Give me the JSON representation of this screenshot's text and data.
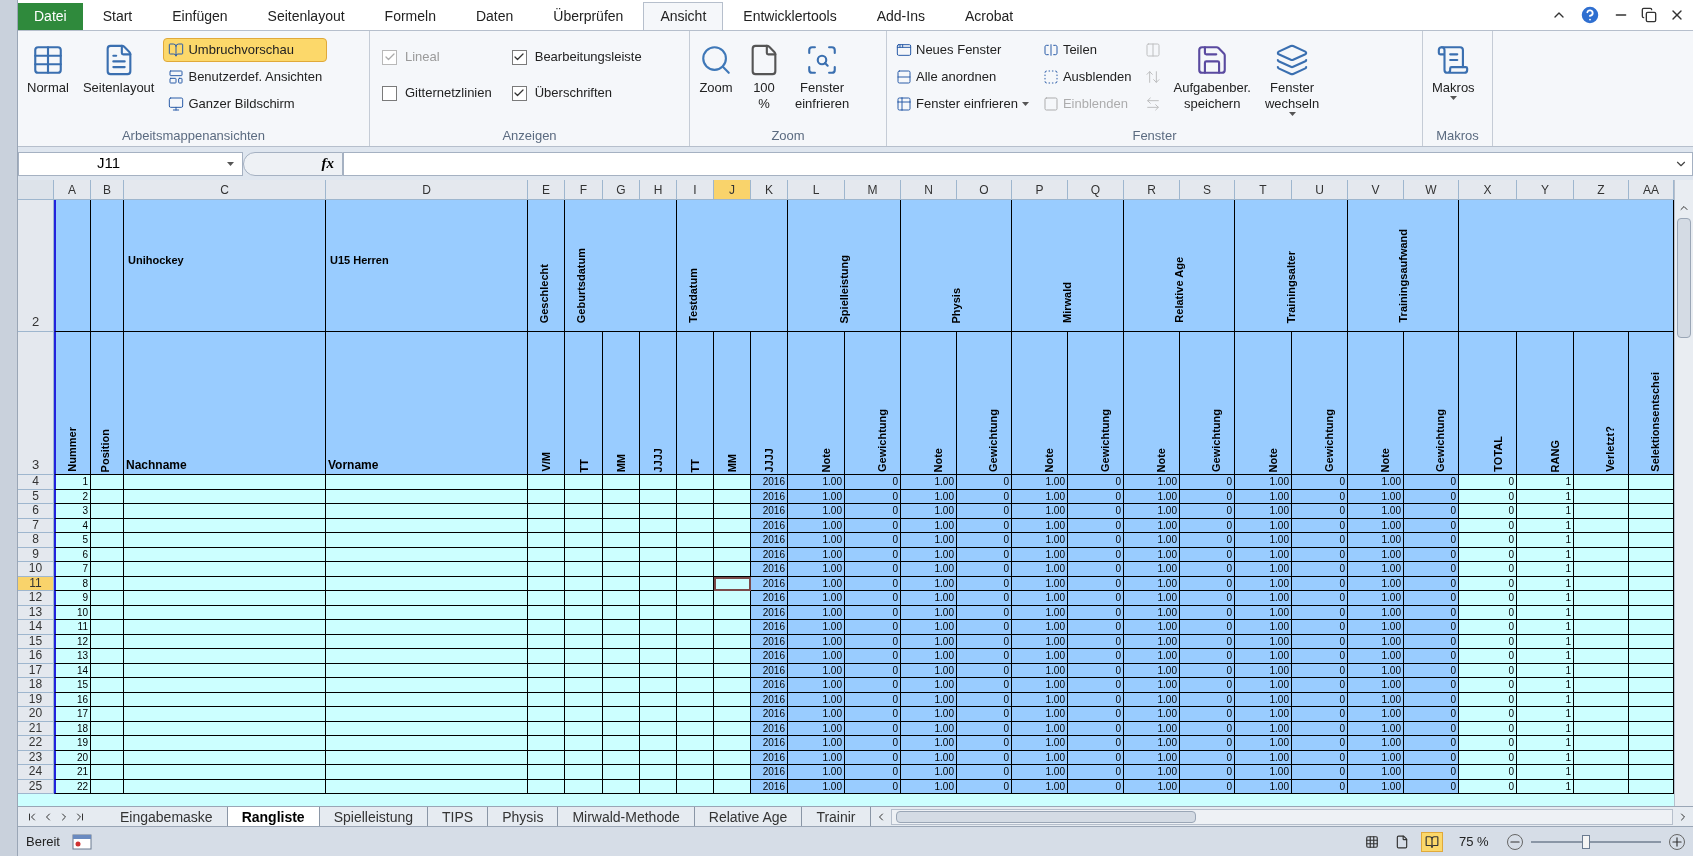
{
  "ribbon_tabs": [
    {
      "label": "Datei",
      "kind": "file",
      "selected": false
    },
    {
      "label": "Start",
      "kind": "tab",
      "selected": false
    },
    {
      "label": "Einfügen",
      "kind": "tab",
      "selected": false
    },
    {
      "label": "Seitenlayout",
      "kind": "tab",
      "selected": false
    },
    {
      "label": "Formeln",
      "kind": "tab",
      "selected": false
    },
    {
      "label": "Daten",
      "kind": "tab",
      "selected": false
    },
    {
      "label": "Überprüfen",
      "kind": "tab",
      "selected": false
    },
    {
      "label": "Ansicht",
      "kind": "tab",
      "selected": true
    },
    {
      "label": "Entwicklertools",
      "kind": "tab",
      "selected": false
    },
    {
      "label": "Add-Ins",
      "kind": "tab",
      "selected": false
    },
    {
      "label": "Acrobat",
      "kind": "tab",
      "selected": false
    }
  ],
  "ribbon_groups": [
    {
      "title": "Arbeitsmappenansichten",
      "items": [
        {
          "kind": "large",
          "label": "Normal",
          "selected": false
        },
        {
          "kind": "large",
          "label": "Seitenlayout",
          "selected": false
        },
        {
          "kind": "small",
          "label": "Umbruchvorschau",
          "selected": true
        },
        {
          "kind": "small",
          "label": "Benutzerdef. Ansichten",
          "selected": false
        },
        {
          "kind": "small",
          "label": "Ganzer Bildschirm",
          "selected": false
        }
      ]
    },
    {
      "title": "Anzeigen",
      "items": [
        {
          "kind": "checkbox",
          "label": "Lineal",
          "checked": true,
          "disabled": true
        },
        {
          "kind": "checkbox",
          "label": "Gitternetzlinien",
          "checked": false,
          "disabled": false
        },
        {
          "kind": "checkbox",
          "label": "Bearbeitungsleiste",
          "checked": true,
          "disabled": false
        },
        {
          "kind": "checkbox",
          "label": "Überschriften",
          "checked": true,
          "disabled": false
        }
      ]
    },
    {
      "title": "Zoom",
      "items": [
        {
          "kind": "large",
          "label": "Zoom"
        },
        {
          "kind": "large",
          "label": "100\n%"
        },
        {
          "kind": "large",
          "label": "Fenster\neinfrieren"
        }
      ]
    },
    {
      "title": "Fenster",
      "items": [
        {
          "kind": "small",
          "label": "Neues Fenster",
          "disabled": false
        },
        {
          "kind": "small",
          "label": "Alle anordnen",
          "disabled": false
        },
        {
          "kind": "small",
          "label": "Fenster einfrieren",
          "dropdown": true,
          "disabled": false
        },
        {
          "kind": "small",
          "label": "Teilen",
          "disabled": false
        },
        {
          "kind": "small",
          "label": "Ausblenden",
          "disabled": false
        },
        {
          "kind": "small",
          "label": "Einblenden",
          "disabled": true
        },
        {
          "kind": "icon",
          "disabled": true
        },
        {
          "kind": "icon",
          "disabled": true
        },
        {
          "kind": "icon",
          "disabled": true
        },
        {
          "kind": "large",
          "label": "Aufgabenber.\nspeichern"
        },
        {
          "kind": "large",
          "label": "Fenster\nwechseln",
          "dropdown": true
        }
      ]
    },
    {
      "title": "Makros",
      "items": [
        {
          "kind": "large",
          "label": "Makros",
          "dropdown": true
        }
      ]
    }
  ],
  "name_box": {
    "value": "J11"
  },
  "formula_bar": {
    "fx_label": "fx"
  },
  "sheet": {
    "columns": [
      {
        "label": "A",
        "selected": false
      },
      {
        "label": "B",
        "selected": false
      },
      {
        "label": "C",
        "selected": false
      },
      {
        "label": "D",
        "selected": false
      },
      {
        "label": "E",
        "selected": false
      },
      {
        "label": "F",
        "selected": false
      },
      {
        "label": "G",
        "selected": false
      },
      {
        "label": "H",
        "selected": false
      },
      {
        "label": "I",
        "selected": false
      },
      {
        "label": "J",
        "selected": true
      },
      {
        "label": "K",
        "selected": false
      },
      {
        "label": "L",
        "selected": false
      },
      {
        "label": "M",
        "selected": false
      },
      {
        "label": "N",
        "selected": false
      },
      {
        "label": "O",
        "selected": false
      },
      {
        "label": "P",
        "selected": false
      },
      {
        "label": "Q",
        "selected": false
      },
      {
        "label": "R",
        "selected": false
      },
      {
        "label": "S",
        "selected": false
      },
      {
        "label": "T",
        "selected": false
      },
      {
        "label": "U",
        "selected": false
      },
      {
        "label": "V",
        "selected": false
      },
      {
        "label": "W",
        "selected": false
      },
      {
        "label": "X",
        "selected": false
      },
      {
        "label": "Y",
        "selected": false
      },
      {
        "label": "Z",
        "selected": false
      },
      {
        "label": "AA",
        "selected": false
      }
    ],
    "header_row_2": {
      "header": "2",
      "cells": [
        {
          "kind": "empty"
        },
        {
          "kind": "empty"
        },
        {
          "kind": "horizontal",
          "label": "Unihockey"
        },
        {
          "kind": "horizontal",
          "label": "U15 Herren"
        },
        {
          "kind": "vertical",
          "label": "Geschlecht"
        },
        {
          "kind": "vertical",
          "label": "Geburtsdatum"
        },
        {
          "kind": "vertical",
          "label": "Testdatum"
        },
        {
          "kind": "vertical",
          "label": "Spielleistung"
        },
        {
          "kind": "vertical",
          "label": "Physis"
        },
        {
          "kind": "vertical",
          "label": "Mirwald"
        },
        {
          "kind": "vertical",
          "label": "Relative Age"
        },
        {
          "kind": "vertical",
          "label": "Trainingsalter"
        },
        {
          "kind": "vertical",
          "label": "Trainingsaufwand"
        },
        {
          "kind": "empty"
        }
      ]
    },
    "header_row_3": {
      "header": "3",
      "cells": [
        {
          "kind": "vertical",
          "label": "Nummer"
        },
        {
          "kind": "vertical",
          "label": "Position"
        },
        {
          "kind": "horizontal",
          "label": "Nachname"
        },
        {
          "kind": "horizontal",
          "label": "Vorname"
        },
        {
          "kind": "vertical",
          "label": "V/M"
        },
        {
          "kind": "vertical",
          "label": "TT"
        },
        {
          "kind": "vertical",
          "label": "MM"
        },
        {
          "kind": "vertical",
          "label": "JJJJ"
        },
        {
          "kind": "vertical",
          "label": "TT"
        },
        {
          "kind": "vertical",
          "label": "MM"
        },
        {
          "kind": "vertical",
          "label": "JJJJ"
        },
        {
          "kind": "vertical",
          "label": "Note"
        },
        {
          "kind": "vertical",
          "label": "Gewichtung"
        },
        {
          "kind": "vertical",
          "label": "Note"
        },
        {
          "kind": "vertical",
          "label": "Gewichtung"
        },
        {
          "kind": "vertical",
          "label": "Note"
        },
        {
          "kind": "vertical",
          "label": "Gewichtung"
        },
        {
          "kind": "vertical",
          "label": "Note"
        },
        {
          "kind": "vertical",
          "label": "Gewichtung"
        },
        {
          "kind": "vertical",
          "label": "Note"
        },
        {
          "kind": "vertical",
          "label": "Gewichtung"
        },
        {
          "kind": "vertical",
          "label": "Note"
        },
        {
          "kind": "vertical",
          "label": "Gewichtung"
        },
        {
          "kind": "vertical",
          "label": "TOTAL"
        },
        {
          "kind": "vertical",
          "label": "RANG"
        },
        {
          "kind": "vertical",
          "label": "Verletzt?"
        },
        {
          "kind": "vertical",
          "label": "Selektionsentschei"
        }
      ]
    },
    "rows": [
      {
        "header": "4",
        "selected": false,
        "number": "1",
        "values": [
          "2016",
          "1.00",
          "0",
          "1.00",
          "0",
          "1.00",
          "0",
          "1.00",
          "0",
          "1.00",
          "0",
          "1.00",
          "0",
          "0",
          "1"
        ]
      },
      {
        "header": "5",
        "selected": false,
        "number": "2",
        "values": [
          "2016",
          "1.00",
          "0",
          "1.00",
          "0",
          "1.00",
          "0",
          "1.00",
          "0",
          "1.00",
          "0",
          "1.00",
          "0",
          "0",
          "1"
        ]
      },
      {
        "header": "6",
        "selected": false,
        "number": "3",
        "values": [
          "2016",
          "1.00",
          "0",
          "1.00",
          "0",
          "1.00",
          "0",
          "1.00",
          "0",
          "1.00",
          "0",
          "1.00",
          "0",
          "0",
          "1"
        ]
      },
      {
        "header": "7",
        "selected": false,
        "number": "4",
        "values": [
          "2016",
          "1.00",
          "0",
          "1.00",
          "0",
          "1.00",
          "0",
          "1.00",
          "0",
          "1.00",
          "0",
          "1.00",
          "0",
          "0",
          "1"
        ]
      },
      {
        "header": "8",
        "selected": false,
        "number": "5",
        "values": [
          "2016",
          "1.00",
          "0",
          "1.00",
          "0",
          "1.00",
          "0",
          "1.00",
          "0",
          "1.00",
          "0",
          "1.00",
          "0",
          "0",
          "1"
        ]
      },
      {
        "header": "9",
        "selected": false,
        "number": "6",
        "values": [
          "2016",
          "1.00",
          "0",
          "1.00",
          "0",
          "1.00",
          "0",
          "1.00",
          "0",
          "1.00",
          "0",
          "1.00",
          "0",
          "0",
          "1"
        ]
      },
      {
        "header": "10",
        "selected": false,
        "number": "7",
        "values": [
          "2016",
          "1.00",
          "0",
          "1.00",
          "0",
          "1.00",
          "0",
          "1.00",
          "0",
          "1.00",
          "0",
          "1.00",
          "0",
          "0",
          "1"
        ]
      },
      {
        "header": "11",
        "selected": true,
        "number": "8",
        "values": [
          "2016",
          "1.00",
          "0",
          "1.00",
          "0",
          "1.00",
          "0",
          "1.00",
          "0",
          "1.00",
          "0",
          "1.00",
          "0",
          "0",
          "1"
        ]
      },
      {
        "header": "12",
        "selected": false,
        "number": "9",
        "values": [
          "2016",
          "1.00",
          "0",
          "1.00",
          "0",
          "1.00",
          "0",
          "1.00",
          "0",
          "1.00",
          "0",
          "1.00",
          "0",
          "0",
          "1"
        ]
      },
      {
        "header": "13",
        "selected": false,
        "number": "10",
        "values": [
          "2016",
          "1.00",
          "0",
          "1.00",
          "0",
          "1.00",
          "0",
          "1.00",
          "0",
          "1.00",
          "0",
          "1.00",
          "0",
          "0",
          "1"
        ]
      },
      {
        "header": "14",
        "selected": false,
        "number": "11",
        "values": [
          "2016",
          "1.00",
          "0",
          "1.00",
          "0",
          "1.00",
          "0",
          "1.00",
          "0",
          "1.00",
          "0",
          "1.00",
          "0",
          "0",
          "1"
        ]
      },
      {
        "header": "15",
        "selected": false,
        "number": "12",
        "values": [
          "2016",
          "1.00",
          "0",
          "1.00",
          "0",
          "1.00",
          "0",
          "1.00",
          "0",
          "1.00",
          "0",
          "1.00",
          "0",
          "0",
          "1"
        ]
      },
      {
        "header": "16",
        "selected": false,
        "number": "13",
        "values": [
          "2016",
          "1.00",
          "0",
          "1.00",
          "0",
          "1.00",
          "0",
          "1.00",
          "0",
          "1.00",
          "0",
          "1.00",
          "0",
          "0",
          "1"
        ]
      },
      {
        "header": "17",
        "selected": false,
        "number": "14",
        "values": [
          "2016",
          "1.00",
          "0",
          "1.00",
          "0",
          "1.00",
          "0",
          "1.00",
          "0",
          "1.00",
          "0",
          "1.00",
          "0",
          "0",
          "1"
        ]
      },
      {
        "header": "18",
        "selected": false,
        "number": "15",
        "values": [
          "2016",
          "1.00",
          "0",
          "1.00",
          "0",
          "1.00",
          "0",
          "1.00",
          "0",
          "1.00",
          "0",
          "1.00",
          "0",
          "0",
          "1"
        ]
      },
      {
        "header": "19",
        "selected": false,
        "number": "16",
        "values": [
          "2016",
          "1.00",
          "0",
          "1.00",
          "0",
          "1.00",
          "0",
          "1.00",
          "0",
          "1.00",
          "0",
          "1.00",
          "0",
          "0",
          "1"
        ]
      },
      {
        "header": "20",
        "selected": false,
        "number": "17",
        "values": [
          "2016",
          "1.00",
          "0",
          "1.00",
          "0",
          "1.00",
          "0",
          "1.00",
          "0",
          "1.00",
          "0",
          "1.00",
          "0",
          "0",
          "1"
        ]
      },
      {
        "header": "21",
        "selected": false,
        "number": "18",
        "values": [
          "2016",
          "1.00",
          "0",
          "1.00",
          "0",
          "1.00",
          "0",
          "1.00",
          "0",
          "1.00",
          "0",
          "1.00",
          "0",
          "0",
          "1"
        ]
      },
      {
        "header": "22",
        "selected": false,
        "number": "19",
        "values": [
          "2016",
          "1.00",
          "0",
          "1.00",
          "0",
          "1.00",
          "0",
          "1.00",
          "0",
          "1.00",
          "0",
          "1.00",
          "0",
          "0",
          "1"
        ]
      },
      {
        "header": "23",
        "selected": false,
        "number": "20",
        "values": [
          "2016",
          "1.00",
          "0",
          "1.00",
          "0",
          "1.00",
          "0",
          "1.00",
          "0",
          "1.00",
          "0",
          "1.00",
          "0",
          "0",
          "1"
        ]
      },
      {
        "header": "24",
        "selected": false,
        "number": "21",
        "values": [
          "2016",
          "1.00",
          "0",
          "1.00",
          "0",
          "1.00",
          "0",
          "1.00",
          "0",
          "1.00",
          "0",
          "1.00",
          "0",
          "0",
          "1"
        ]
      },
      {
        "header": "25",
        "selected": false,
        "number": "22",
        "values": [
          "2016",
          "1.00",
          "0",
          "1.00",
          "0",
          "1.00",
          "0",
          "1.00",
          "0",
          "1.00",
          "0",
          "1.00",
          "0",
          "0",
          "1"
        ]
      }
    ]
  },
  "sheet_tabs": [
    {
      "label": "Eingabemaske",
      "selected": false
    },
    {
      "label": "Rangliste",
      "selected": true
    },
    {
      "label": "Spielleistung",
      "selected": false
    },
    {
      "label": "TIPS",
      "selected": false
    },
    {
      "label": "Physis",
      "selected": false
    },
    {
      "label": "Mirwald-Methode",
      "selected": false
    },
    {
      "label": "Relative Age",
      "selected": false
    },
    {
      "label": "Trainir",
      "selected": false
    }
  ],
  "status_bar": {
    "status": "Bereit",
    "view_buttons": [
      {
        "selected": false
      },
      {
        "selected": false
      },
      {
        "selected": true
      }
    ],
    "zoom": "75 %",
    "zoom_slider": {
      "level": 0.42
    }
  }
}
